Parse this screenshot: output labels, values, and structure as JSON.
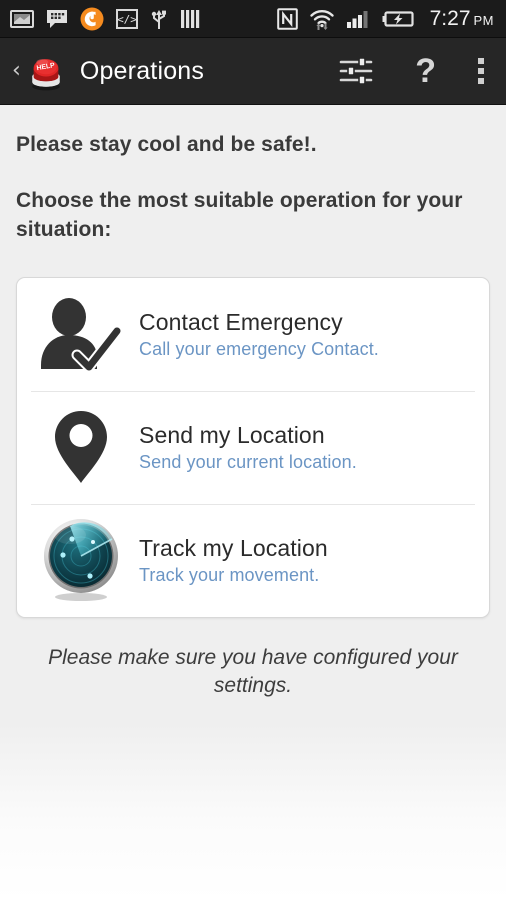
{
  "status_bar": {
    "icons": [
      {
        "name": "screenshot-icon",
        "label": "screenshot"
      },
      {
        "name": "bbm-message-icon",
        "label": "bbm message"
      },
      {
        "name": "orange-circle-app-icon",
        "label": "app notification"
      },
      {
        "name": "code-developer-icon",
        "label": "developer mode"
      },
      {
        "name": "usb-icon",
        "label": "usb connected"
      },
      {
        "name": "sim-bars-icon",
        "label": "sim"
      }
    ],
    "right_icons": [
      {
        "name": "nfc-icon",
        "label": "nfc"
      },
      {
        "name": "wifi-icon",
        "label": "wifi with data transfer"
      },
      {
        "name": "signal-bars-icon",
        "label": "cellular signal"
      },
      {
        "name": "battery-charging-icon",
        "label": "battery charging"
      }
    ],
    "time": "7:27",
    "meridiem": "PM"
  },
  "action_bar": {
    "back_label": "‹",
    "app_icon_name": "help-button-logo",
    "title": "Operations",
    "actions": [
      {
        "name": "settings-sliders-button",
        "label": "Settings"
      },
      {
        "name": "help-button",
        "label": "?"
      },
      {
        "name": "overflow-menu-button",
        "label": "More options"
      }
    ]
  },
  "content": {
    "headline": "Please stay cool and be safe!.",
    "subhead": "Choose the most suitable operation for your situation:",
    "operations": [
      {
        "icon": "contact-person-check-icon",
        "title": "Contact Emergency",
        "subtitle": "Call your emergency Contact."
      },
      {
        "icon": "map-pin-icon",
        "title": "Send my Location",
        "subtitle": "Send your current location."
      },
      {
        "icon": "radar-scope-icon",
        "title": "Track my Location",
        "subtitle": "Track your movement."
      }
    ],
    "footer_note": "Please make sure you have configured your settings."
  },
  "colors": {
    "status_bar_bg": "#1b1b1b",
    "action_bar_bg": "#262626",
    "content_bg": "#efefef",
    "card_bg": "#ffffff",
    "title_text": "#2b2b2b",
    "subtitle_blue": "#6b95c4",
    "heading_text": "#3a3a3a",
    "logo_red": "#d92121",
    "radar_teal": "#2fc6d8"
  }
}
